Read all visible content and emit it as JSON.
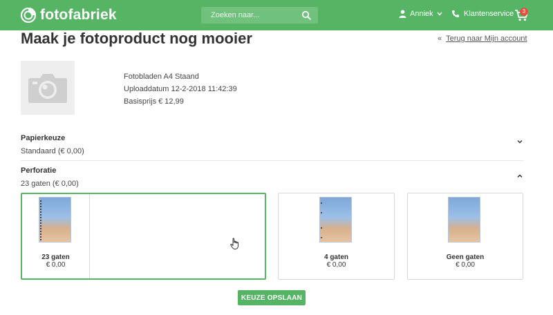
{
  "header": {
    "brand": "fotofabriek",
    "search": {
      "placeholder": "Zoeken naar..."
    },
    "user_name": "Anniek",
    "service_label": "Klantenservice",
    "cart_count": "3",
    "colors": {
      "primary": "#55b565",
      "badge": "#e74c3c"
    }
  },
  "page": {
    "title": "Maak je fotoproduct nog mooier",
    "back_prefix": "«",
    "back_link": "Terug naar Mijn account"
  },
  "product": {
    "name": "Fotobladen A4 Staand",
    "upload": "Uploaddatum 12-2-2018 11:42:39",
    "price": "Basisprijs € 12,99",
    "icon": "camera-icon"
  },
  "sections": {
    "paper": {
      "title": "Papierkeuze",
      "value": "Standaard (€ 0,00)",
      "state": "collapsed"
    },
    "perforation": {
      "title": "Perforatie",
      "value": "23 gaten (€ 0,00)",
      "state": "expanded"
    }
  },
  "options": [
    {
      "name": "23 gaten",
      "price": "€ 0,00",
      "selected": true
    },
    {
      "name": "4 gaten",
      "price": "€ 0,00",
      "selected": false
    },
    {
      "name": "Geen gaten",
      "price": "€ 0,00",
      "selected": false
    }
  ],
  "actions": {
    "save_label": "KEUZE OPSLAAN"
  }
}
